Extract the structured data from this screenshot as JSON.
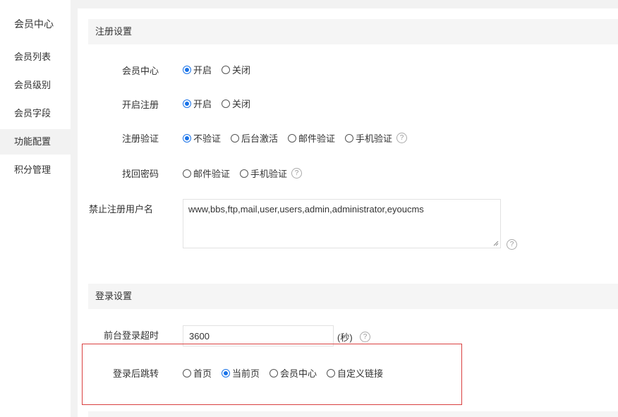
{
  "sidebar": {
    "title": "会员中心",
    "items": [
      {
        "label": "会员列表"
      },
      {
        "label": "会员级别"
      },
      {
        "label": "会员字段"
      },
      {
        "label": "功能配置"
      },
      {
        "label": "积分管理"
      }
    ],
    "active_index": 3
  },
  "register": {
    "header": "注册设置",
    "member_center": {
      "label": "会员中心",
      "options": [
        "开启",
        "关闭"
      ],
      "selected": "开启"
    },
    "open_register": {
      "label": "开启注册",
      "options": [
        "开启",
        "关闭"
      ],
      "selected": "开启"
    },
    "verify": {
      "label": "注册验证",
      "options": [
        "不验证",
        "后台激活",
        "邮件验证",
        "手机验证"
      ],
      "selected": "不验证"
    },
    "recover": {
      "label": "找回密码",
      "options": [
        "邮件验证",
        "手机验证"
      ],
      "selected": ""
    },
    "banned": {
      "label": "禁止注册用户名",
      "value": "www,bbs,ftp,mail,user,users,admin,administrator,eyoucms"
    }
  },
  "login": {
    "header": "登录设置",
    "timeout": {
      "label": "前台登录超时",
      "value": "3600",
      "unit": "(秒)"
    },
    "redirect": {
      "label": "登录后跳转",
      "options": [
        "首页",
        "当前页",
        "会员中心",
        "自定义链接"
      ],
      "selected": "当前页"
    }
  },
  "help_glyph": "?",
  "colors": {
    "accent": "#1a73e8",
    "highlight_border": "#d94040"
  }
}
